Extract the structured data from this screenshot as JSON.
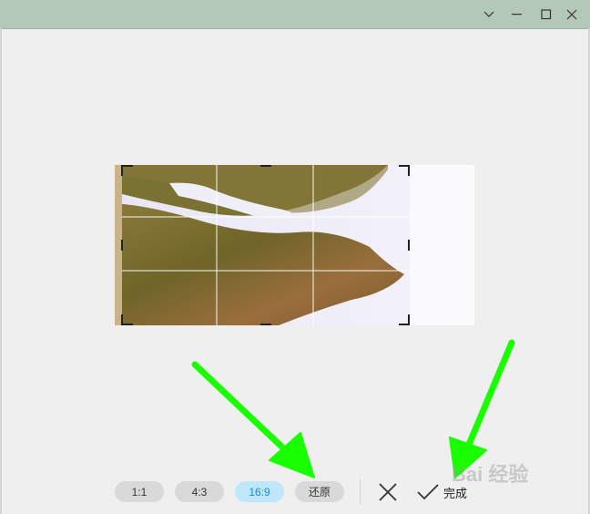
{
  "window": {
    "buttons": [
      "chevron-down-icon",
      "minimize-icon",
      "maximize-icon",
      "close-icon"
    ]
  },
  "toolbar": {
    "ratio_1_1": "1:1",
    "ratio_4_3": "4:3",
    "ratio_16_9": "16:9",
    "restore": "还原",
    "done": "完成",
    "selected_ratio": "16:9"
  },
  "watermark": {
    "text": "Bai 经验"
  },
  "colors": {
    "titlebar": "#b4c8b7",
    "selected_ratio_bg": "#bfe6f9",
    "selected_ratio_text": "#0a92d6",
    "arrow": "#19ff00"
  }
}
